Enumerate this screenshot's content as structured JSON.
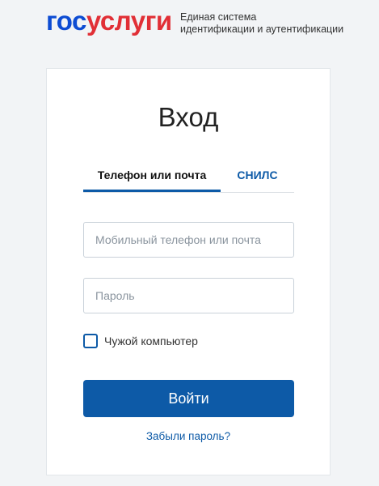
{
  "header": {
    "logo_part1": "гос",
    "logo_part2": "услуги",
    "tagline_line1": "Единая система",
    "tagline_line2": "идентификации и аутентификации"
  },
  "login": {
    "title": "Вход",
    "tabs": [
      {
        "label": "Телефон или почта",
        "active": true
      },
      {
        "label": "СНИЛС",
        "active": false
      }
    ],
    "login_placeholder": "Мобильный телефон или почта",
    "login_value": "",
    "password_placeholder": "Пароль",
    "password_value": "",
    "checkbox_label": "Чужой компьютер",
    "checkbox_checked": false,
    "submit_label": "Войти",
    "forgot_label": "Забыли пароль?"
  },
  "colors": {
    "brand_blue": "#0d4cd3",
    "brand_red": "#e12f36",
    "primary": "#0d5aa7",
    "background": "#f2f4f6"
  }
}
